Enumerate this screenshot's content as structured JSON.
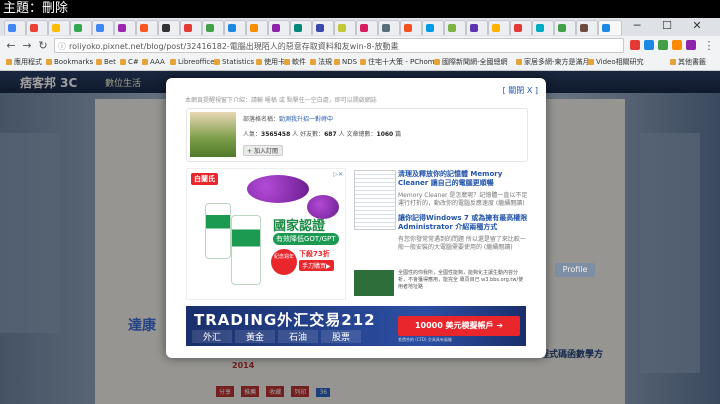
{
  "top_title": "主題：刪除",
  "browser": {
    "url": "roliyoko.pixnet.net/blog/post/32416182-電腦出現陌人的惡意存取資料和友win-8-放動畫",
    "bookmarks": [
      "應用程式",
      "Bookmarks",
      "Bet",
      "C#",
      "AAA",
      "Libreoffice",
      "Statistics",
      "使用卡",
      "軟件",
      "法規",
      "NDS",
      "住宅十大策 - PChome",
      "國際新聞網-全國總網",
      "家居多網-東方是滿月",
      "Video相關研究",
      "其他書籤"
    ]
  },
  "blog": {
    "logo": "痞客邦 3C",
    "nav": "數位生活",
    "profile": "Profile"
  },
  "modal": {
    "close": "[ 關閉 X ]",
    "notice": "本網頁提醒視窗下介紹：請輸 暱稱 或 點擊任一空白處，即可以開啟網誌",
    "user_label": "部落格名稱：",
    "user_name": "勁測我升招一對峙中",
    "stats_label_popularity": "人氣：",
    "stats_popularity": "3565458",
    "stats_unit_people": "人",
    "stats_label_friends": "好友數：",
    "stats_friends": "687",
    "stats_label_articles": "文章總數：",
    "stats_articles": "1060",
    "stats_unit_posts": "篇",
    "follow": "加入訂閱"
  },
  "ad_left": {
    "brand": "白蘭氏",
    "certified": "國家認證",
    "effect": "有效降低GOT/GPT",
    "anniversary": "紀念週年",
    "promo": "下殺73折",
    "buy": "手刀購買▶"
  },
  "articles": [
    {
      "title": "清理及釋放你的記憶體 Memory Cleaner 讓自己的電腦更順暢",
      "body": "Memory Cleaner 是怎麼呢？記憶體一直以不足運行打折的，動改你的電腦反應速度 (繼續閱讀)"
    },
    {
      "title": "讓你記得Windows 7 或為擁有最高權限Administrator 介紹兩種方式",
      "body": "有您你發常常遇到的問題 所以還是留了來比較一般一般安裝的大電腦需要使用的 (繼續閱讀)"
    }
  ],
  "mini_ad": {
    "text": "全國性的你我所，全國性能夠，能夠化主讓生動內容分析，不會獲得應用，能完全 專頁目已 w3.bbs.org.tw/使用者地址路"
  },
  "ad_bottom": {
    "headline": "TRADING外汇交易212",
    "cells": [
      "外汇",
      "黃金",
      "石油",
      "股票"
    ],
    "cta": "10000 美元模擬帳戶 ➔",
    "warning": "差價合約 (CFD) 交易具有風險"
  },
  "side_text": {
    "left_blue": "達康",
    "right": "程式碼函數學方"
  },
  "bottom_tabs": [
    "分享",
    "推薦",
    "收藏",
    "列印",
    "36"
  ],
  "year": "2014"
}
